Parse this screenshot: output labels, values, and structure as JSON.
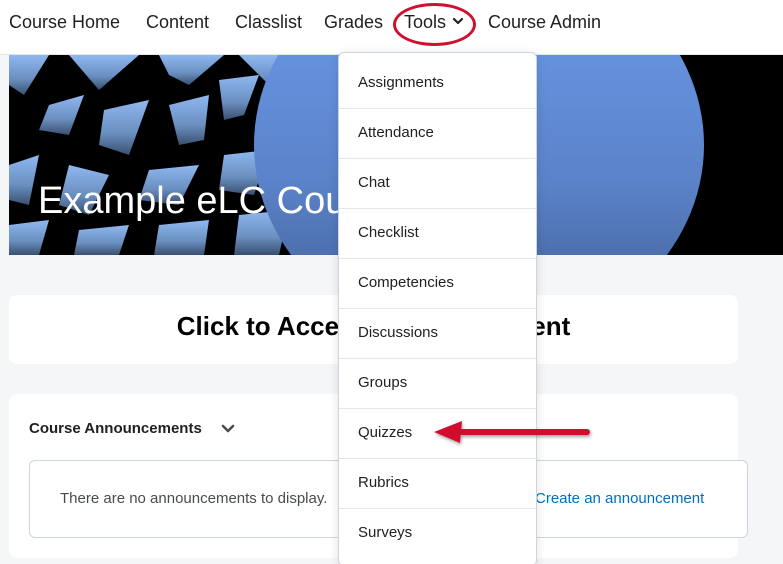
{
  "nav": {
    "items": [
      {
        "label": "Course Home"
      },
      {
        "label": "Content"
      },
      {
        "label": "Classlist"
      },
      {
        "label": "Grades"
      },
      {
        "label": "Tools",
        "has_dropdown": true,
        "expanded": true
      },
      {
        "label": "Course Admin"
      }
    ]
  },
  "banner": {
    "title": "Example eLC Course"
  },
  "content_card": {
    "title": "Click to Access Course Content"
  },
  "announcements": {
    "header": "Course Announcements",
    "empty_text": "There are no announcements to display.",
    "link_text": "Create an announcement"
  },
  "tools_menu": {
    "items": [
      {
        "label": "Assignments"
      },
      {
        "label": "Attendance"
      },
      {
        "label": "Chat"
      },
      {
        "label": "Checklist"
      },
      {
        "label": "Competencies"
      },
      {
        "label": "Discussions"
      },
      {
        "label": "Groups"
      },
      {
        "label": "Quizzes",
        "highlighted": true
      },
      {
        "label": "Rubrics"
      },
      {
        "label": "Surveys"
      }
    ]
  },
  "annotation": {
    "color": "#d0102f",
    "circled_item": "Tools",
    "arrow_target": "Quizzes"
  },
  "colors": {
    "link": "#006fbf",
    "background": "#f5f6f8"
  }
}
